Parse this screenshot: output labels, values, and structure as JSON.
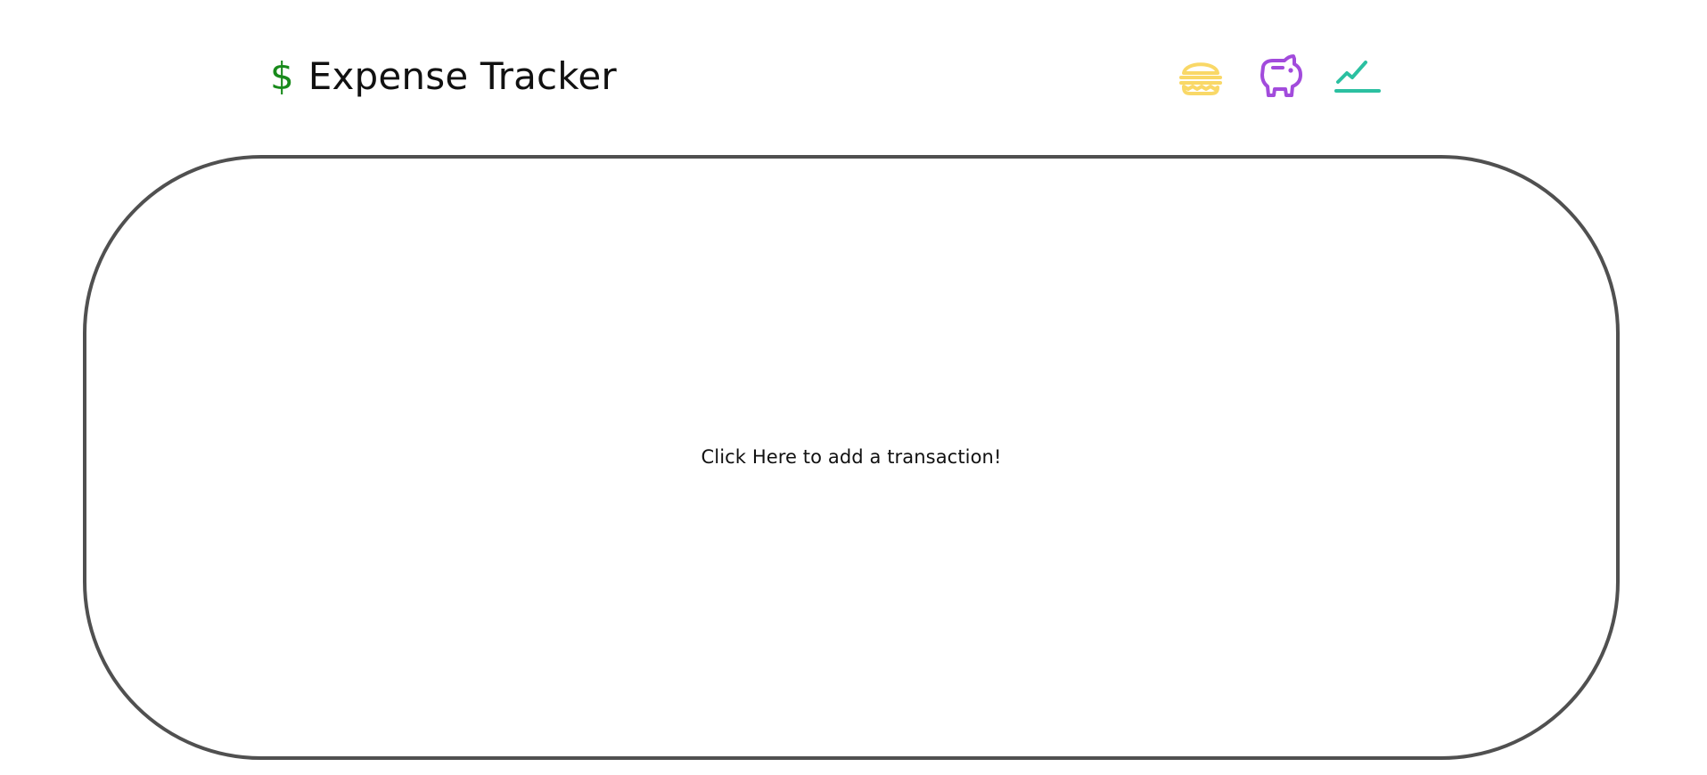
{
  "header": {
    "brand_symbol": "$",
    "title": "Expense Tracker"
  },
  "nav": {
    "icons": [
      {
        "name": "hamburger-icon",
        "color": "#F9D867"
      },
      {
        "name": "piggy-bank-icon",
        "color": "#A24BDC"
      },
      {
        "name": "trend-chart-icon",
        "color": "#2BC0A1"
      }
    ]
  },
  "main": {
    "cta_text": "Click Here to add a transaction!"
  },
  "colors": {
    "brand_accent": "#188A1B",
    "card_border": "#505050",
    "text": "#111111"
  }
}
